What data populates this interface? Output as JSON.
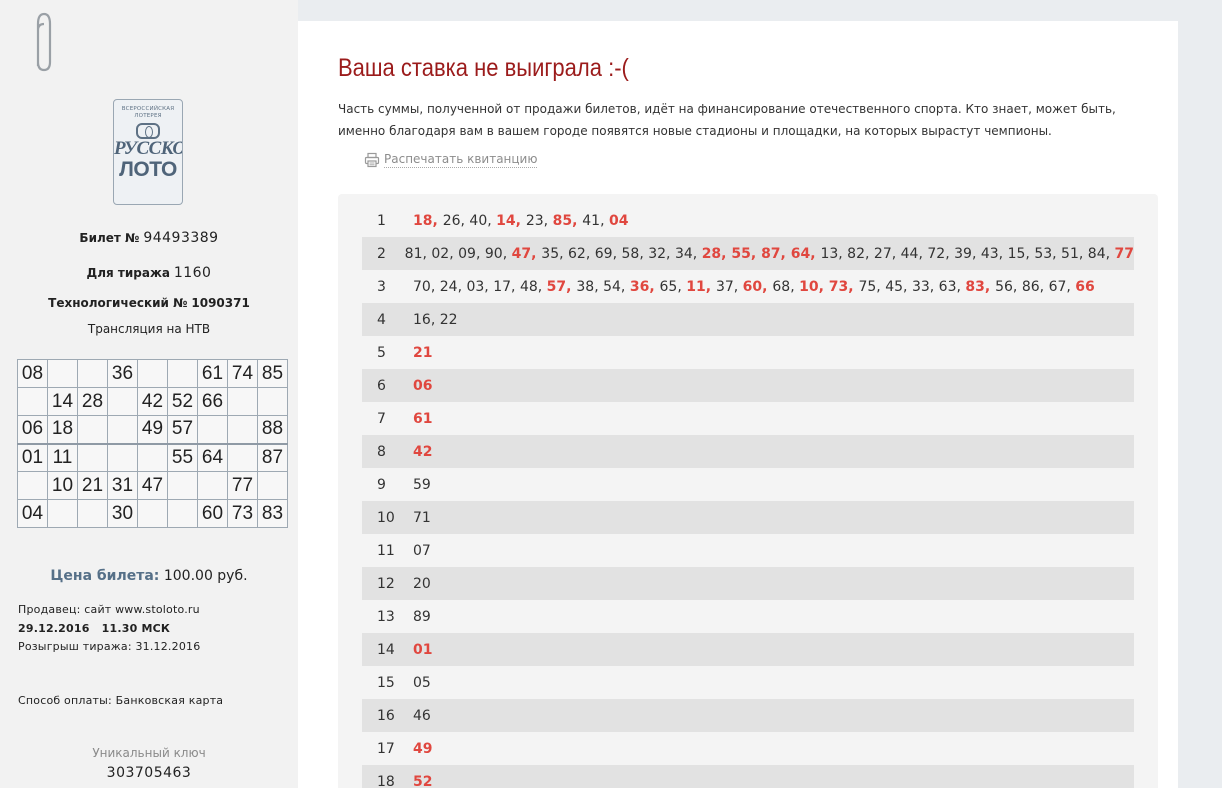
{
  "sidebar": {
    "logo": {
      "top_text": "ВСЕРОССИЙСКАЯ ЛОТЕРЕЯ",
      "line1": "РУССКОЕ",
      "line2": "ЛОТО"
    },
    "ticket_label": "Билет №",
    "ticket_number": "94493389",
    "draw_label": "Для тиража",
    "draw_number": "1160",
    "tech_label": "Технологический №",
    "tech_number": "1090371",
    "broadcast": "Трансляция на НТВ",
    "card": [
      [
        "08",
        "",
        "",
        "36",
        "",
        "",
        "61",
        "74",
        "85"
      ],
      [
        "",
        "14",
        "28",
        "",
        "42",
        "52",
        "66",
        "",
        ""
      ],
      [
        "06",
        "18",
        "",
        "",
        "49",
        "57",
        "",
        "",
        "88"
      ],
      [
        "01",
        "11",
        "",
        "",
        "",
        "55",
        "64",
        "",
        "87"
      ],
      [
        "",
        "10",
        "21",
        "31",
        "47",
        "",
        "",
        "77",
        ""
      ],
      [
        "04",
        "",
        "",
        "30",
        "",
        "",
        "60",
        "73",
        "83"
      ]
    ],
    "price_label": "Цена билета:",
    "price_value": "100.00 руб.",
    "seller": "Продавец: сайт www.stoloto.ru",
    "datetime": "29.12.2016   11.30 МСК",
    "draw_date": "Розыгрыш тиража: 31.12.2016",
    "payment": "Способ оплаты: Банковская карта",
    "unique_key_label": "Уникальный ключ",
    "unique_key": "303705463"
  },
  "main": {
    "title": "Ваша ставка не выиграла :-(",
    "description": "Часть суммы, полученной от продажи билетов, идёт на финансирование отечественного спорта. Кто знает, может быть, именно благодаря вам в вашем городе появятся новые стадионы и площадки, на которых вырастут чемпионы.",
    "print_label": "Распечатать квитанцию",
    "hit_color": "#e0473f",
    "rounds": [
      {
        "n": "1",
        "numbers": [
          [
            "18",
            1
          ],
          [
            "26",
            0
          ],
          [
            "40",
            0
          ],
          [
            "14",
            1
          ],
          [
            "23",
            0
          ],
          [
            "85",
            1
          ],
          [
            "41",
            0
          ],
          [
            "04",
            1
          ]
        ]
      },
      {
        "n": "2",
        "numbers": [
          [
            "81",
            0
          ],
          [
            "02",
            0
          ],
          [
            "09",
            0
          ],
          [
            "90",
            0
          ],
          [
            "47",
            1
          ],
          [
            "35",
            0
          ],
          [
            "62",
            0
          ],
          [
            "69",
            0
          ],
          [
            "58",
            0
          ],
          [
            "32",
            0
          ],
          [
            "34",
            0
          ],
          [
            "28",
            1
          ],
          [
            "55",
            1
          ],
          [
            "87",
            1
          ],
          [
            "64",
            1
          ],
          [
            "13",
            0
          ],
          [
            "82",
            0
          ],
          [
            "27",
            0
          ],
          [
            "44",
            0
          ],
          [
            "72",
            0
          ],
          [
            "39",
            0
          ],
          [
            "43",
            0
          ],
          [
            "15",
            0
          ],
          [
            "53",
            0
          ],
          [
            "51",
            0
          ],
          [
            "84",
            0
          ],
          [
            "77",
            1
          ]
        ]
      },
      {
        "n": "3",
        "numbers": [
          [
            "70",
            0
          ],
          [
            "24",
            0
          ],
          [
            "03",
            0
          ],
          [
            "17",
            0
          ],
          [
            "48",
            0
          ],
          [
            "57",
            1
          ],
          [
            "38",
            0
          ],
          [
            "54",
            0
          ],
          [
            "36",
            1
          ],
          [
            "65",
            0
          ],
          [
            "11",
            1
          ],
          [
            "37",
            0
          ],
          [
            "60",
            1
          ],
          [
            "68",
            0
          ],
          [
            "10",
            1
          ],
          [
            "73",
            1
          ],
          [
            "75",
            0
          ],
          [
            "45",
            0
          ],
          [
            "33",
            0
          ],
          [
            "63",
            0
          ],
          [
            "83",
            1
          ],
          [
            "56",
            0
          ],
          [
            "86",
            0
          ],
          [
            "67",
            0
          ],
          [
            "66",
            1
          ]
        ]
      },
      {
        "n": "4",
        "numbers": [
          [
            "16",
            0
          ],
          [
            "22",
            0
          ]
        ]
      },
      {
        "n": "5",
        "numbers": [
          [
            "21",
            1
          ]
        ]
      },
      {
        "n": "6",
        "numbers": [
          [
            "06",
            1
          ]
        ]
      },
      {
        "n": "7",
        "numbers": [
          [
            "61",
            1
          ]
        ]
      },
      {
        "n": "8",
        "numbers": [
          [
            "42",
            1
          ]
        ]
      },
      {
        "n": "9",
        "numbers": [
          [
            "59",
            0
          ]
        ]
      },
      {
        "n": "10",
        "numbers": [
          [
            "71",
            0
          ]
        ]
      },
      {
        "n": "11",
        "numbers": [
          [
            "07",
            0
          ]
        ]
      },
      {
        "n": "12",
        "numbers": [
          [
            "20",
            0
          ]
        ]
      },
      {
        "n": "13",
        "numbers": [
          [
            "89",
            0
          ]
        ]
      },
      {
        "n": "14",
        "numbers": [
          [
            "01",
            1
          ]
        ]
      },
      {
        "n": "15",
        "numbers": [
          [
            "05",
            0
          ]
        ]
      },
      {
        "n": "16",
        "numbers": [
          [
            "46",
            0
          ]
        ]
      },
      {
        "n": "17",
        "numbers": [
          [
            "49",
            1
          ]
        ]
      },
      {
        "n": "18",
        "numbers": [
          [
            "52",
            1
          ]
        ]
      }
    ]
  }
}
